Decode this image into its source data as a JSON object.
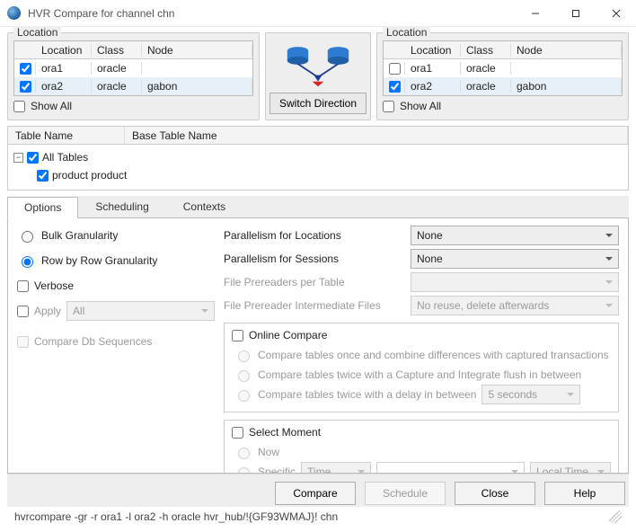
{
  "window": {
    "title": "HVR Compare for channel chn"
  },
  "location_left": {
    "legend": "Location",
    "headers": {
      "loc": "Location",
      "class": "Class",
      "node": "Node"
    },
    "rows": [
      {
        "checked": true,
        "loc": "ora1",
        "class": "oracle",
        "node": ""
      },
      {
        "checked": true,
        "loc": "ora2",
        "class": "oracle",
        "node": "gabon"
      }
    ],
    "show_all": "Show All"
  },
  "switch_btn": "Switch Direction",
  "location_right": {
    "legend": "Location",
    "headers": {
      "loc": "Location",
      "class": "Class",
      "node": "Node"
    },
    "rows": [
      {
        "checked": false,
        "loc": "ora1",
        "class": "oracle",
        "node": ""
      },
      {
        "checked": true,
        "loc": "ora2",
        "class": "oracle",
        "node": "gabon"
      }
    ],
    "show_all": "Show All"
  },
  "tables": {
    "headers": {
      "name": "Table Name",
      "base": "Base Table Name"
    },
    "root": "All Tables",
    "child": "product product"
  },
  "tabs": {
    "options": "Options",
    "scheduling": "Scheduling",
    "contexts": "Contexts"
  },
  "options": {
    "bulk": "Bulk Granularity",
    "rowbyrow": "Row by Row Granularity",
    "verbose": "Verbose",
    "apply": "Apply",
    "apply_value": "All",
    "compare_db_seq": "Compare Db Sequences",
    "par_loc_lbl": "Parallelism for Locations",
    "par_loc_val": "None",
    "par_sess_lbl": "Parallelism for Sessions",
    "par_sess_val": "None",
    "file_pre_lbl": "File Prereaders per Table",
    "file_pre_int_lbl": "File Prereader Intermediate Files",
    "file_pre_int_val": "No reuse, delete afterwards",
    "online_compare": "Online Compare",
    "oc_opt1": "Compare tables once and combine differences with captured transactions",
    "oc_opt2": "Compare tables twice with a Capture and Integrate flush in between",
    "oc_opt3": "Compare tables twice with a delay in between",
    "oc_delay_val": "5 seconds",
    "select_moment": "Select Moment",
    "sm_now": "Now",
    "sm_specific": "Specific",
    "sm_time_val": "Time",
    "sm_tz_val": "Local Time"
  },
  "buttons": {
    "compare": "Compare",
    "schedule": "Schedule",
    "close": "Close",
    "help": "Help"
  },
  "cmdline": "hvrcompare -gr -r ora1 -l ora2 -h oracle hvr_hub/!{GF93WMAJ}! chn"
}
